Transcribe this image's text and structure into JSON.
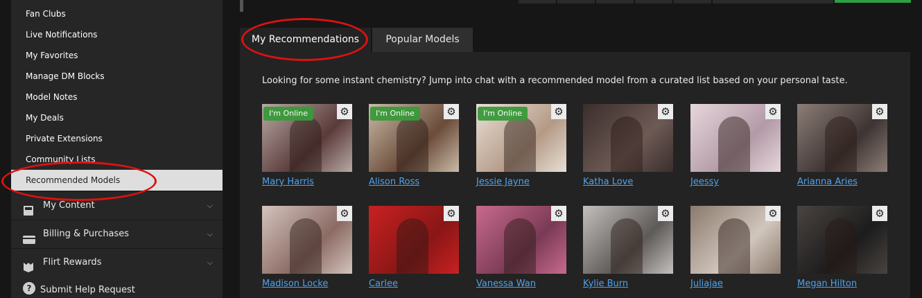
{
  "sidebar": {
    "sub_items": [
      {
        "label": "Fan Clubs"
      },
      {
        "label": "Live Notifications"
      },
      {
        "label": "My Favorites"
      },
      {
        "label": "Manage DM Blocks"
      },
      {
        "label": "Model Notes"
      },
      {
        "label": "My Deals"
      },
      {
        "label": "Private Extensions"
      },
      {
        "label": "Community Lists"
      },
      {
        "label": "Recommended Models"
      }
    ],
    "main_items": [
      {
        "label": "My Content"
      },
      {
        "label": "Billing & Purchases"
      },
      {
        "label": "Flirt Rewards"
      }
    ],
    "help_label": "Submit Help Request"
  },
  "tabs": {
    "active": "My Recommendations",
    "inactive": "Popular Models"
  },
  "intro": "Looking for some instant chemistry? Jump into chat with a recommended model from a curated list based on your personal taste.",
  "online_label": "I'm Online",
  "models": [
    {
      "name": "Mary Harris",
      "online": true
    },
    {
      "name": "Alison Ross",
      "online": true
    },
    {
      "name": "Jessie Jayne",
      "online": true
    },
    {
      "name": "Katha Love",
      "online": false
    },
    {
      "name": "Jeessy",
      "online": false
    },
    {
      "name": "Arianna Aries",
      "online": false
    },
    {
      "name": "Madison Locke",
      "online": false
    },
    {
      "name": "Carlee",
      "online": false
    },
    {
      "name": "Vanessa Wan",
      "online": false
    },
    {
      "name": "Kylie Burn",
      "online": false
    },
    {
      "name": "Juliajae",
      "online": false
    },
    {
      "name": "Megan Hilton",
      "online": false
    }
  ],
  "colors": {
    "link": "#4da3f0",
    "online_badge": "#3a9a3a",
    "annotation": "#dd1111"
  }
}
